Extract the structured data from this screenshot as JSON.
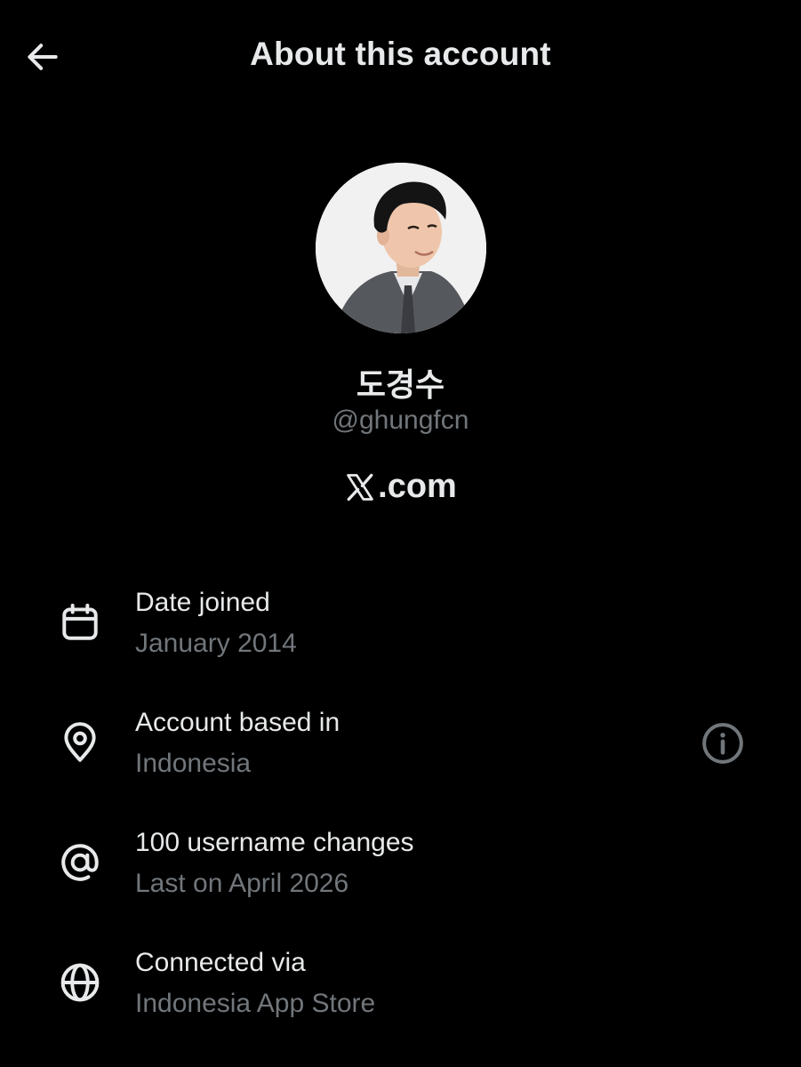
{
  "header": {
    "title": "About this account",
    "back_icon": "arrow-left-icon"
  },
  "profile": {
    "display_name": "도경수",
    "handle": "@ghungfcn",
    "brand_suffix": ".com"
  },
  "rows": [
    {
      "icon": "calendar-icon",
      "label": "Date joined",
      "value": "January 2014"
    },
    {
      "icon": "location-pin-icon",
      "label": "Account based in",
      "value": "Indonesia",
      "trailing_icon": "info-icon"
    },
    {
      "icon": "at-sign-icon",
      "label": "100 username changes",
      "value": "Last on April 2026"
    },
    {
      "icon": "globe-icon",
      "label": "Connected via",
      "value": "Indonesia App Store"
    }
  ],
  "colors": {
    "background": "#000000",
    "primary_text": "#e7e9ea",
    "secondary_text": "#71767b"
  }
}
